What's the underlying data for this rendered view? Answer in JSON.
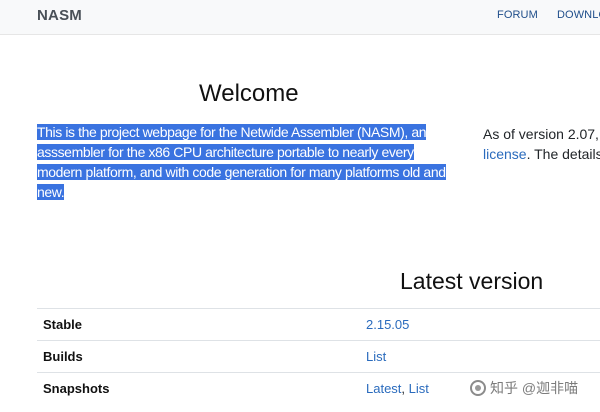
{
  "navbar": {
    "brand": "NASM",
    "links": [
      {
        "label": "FORUM"
      },
      {
        "label": "DOWNLO"
      }
    ]
  },
  "welcome": {
    "title": "Welcome",
    "paragraph": "This is the project webpage for the Netwide Assembler (NASM), an asssembler for the x86 CPU architecture portable to nearly every modern platform, and with code generation for many platforms old and new.",
    "selection_color": "#3a73e0"
  },
  "side": {
    "line1": "As of version 2.07,",
    "license_link": "license",
    "line2_rest": ". The details"
  },
  "latest": {
    "title": "Latest version",
    "rows": [
      {
        "label": "Stable",
        "value": "2.15.05"
      },
      {
        "label": "Builds",
        "value": "List"
      },
      {
        "label": "Snapshots",
        "value_a": "Latest",
        "separator": ", ",
        "value_b": "List"
      }
    ]
  },
  "watermark": {
    "text": "知乎 @迦非喵"
  },
  "colors": {
    "link": "#2a6bbd",
    "nav_link": "#1f4e8a",
    "navbar_bg": "#f8f9fa"
  }
}
